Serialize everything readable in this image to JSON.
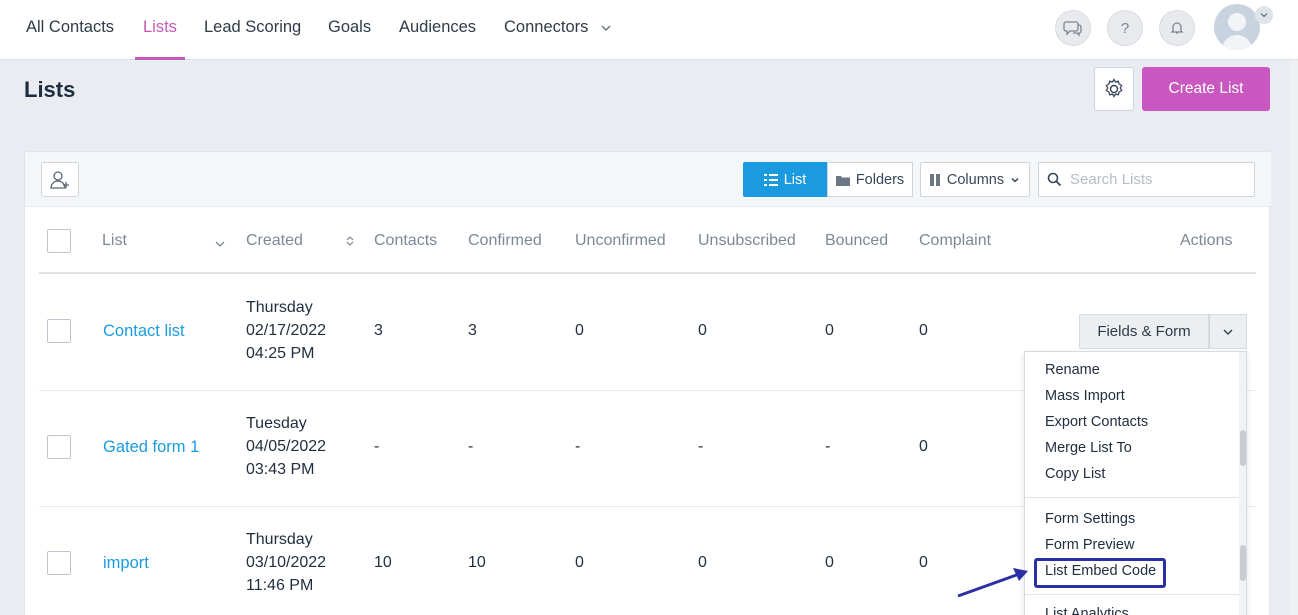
{
  "nav": {
    "items": [
      {
        "label": "All Contacts"
      },
      {
        "label": "Lists"
      },
      {
        "label": "Lead Scoring"
      },
      {
        "label": "Goals"
      },
      {
        "label": "Audiences"
      },
      {
        "label": "Connectors"
      }
    ],
    "active": "Lists",
    "help_symbol": "?"
  },
  "page": {
    "title": "Lists",
    "create_button": "Create List"
  },
  "toolbar": {
    "view_list": "List",
    "view_folders": "Folders",
    "columns": "Columns",
    "search_placeholder": "Search Lists"
  },
  "table": {
    "headers": [
      "List",
      "Created",
      "Contacts",
      "Confirmed",
      "Unconfirmed",
      "Unsubscribed",
      "Bounced",
      "Complaint",
      "Actions"
    ],
    "rows": [
      {
        "name": "Contact list",
        "day": "Thursday",
        "date": "02/17/2022",
        "time": "04:25 PM",
        "contacts": "3",
        "confirmed": "3",
        "unconfirmed": "0",
        "unsubscribed": "0",
        "bounced": "0",
        "complaint": "0"
      },
      {
        "name": "Gated form 1",
        "day": "Tuesday",
        "date": "04/05/2022",
        "time": "03:43 PM",
        "contacts": "-",
        "confirmed": "-",
        "unconfirmed": "-",
        "unsubscribed": "-",
        "bounced": "-",
        "complaint": "0"
      },
      {
        "name": "import",
        "day": "Thursday",
        "date": "03/10/2022",
        "time": "11:46 PM",
        "contacts": "10",
        "confirmed": "10",
        "unconfirmed": "0",
        "unsubscribed": "0",
        "bounced": "0",
        "complaint": "0"
      }
    ],
    "action_button": "Fields & Form"
  },
  "dropdown": {
    "group1": [
      "Rename",
      "Mass Import",
      "Export Contacts",
      "Merge List To",
      "Copy List"
    ],
    "group2": [
      "Form Settings",
      "Form Preview",
      "List Embed Code"
    ],
    "partial": "List Analytics"
  },
  "colors": {
    "accent": "#c957c0",
    "link": "#1a9be0",
    "highlight": "#2b2fa4"
  }
}
